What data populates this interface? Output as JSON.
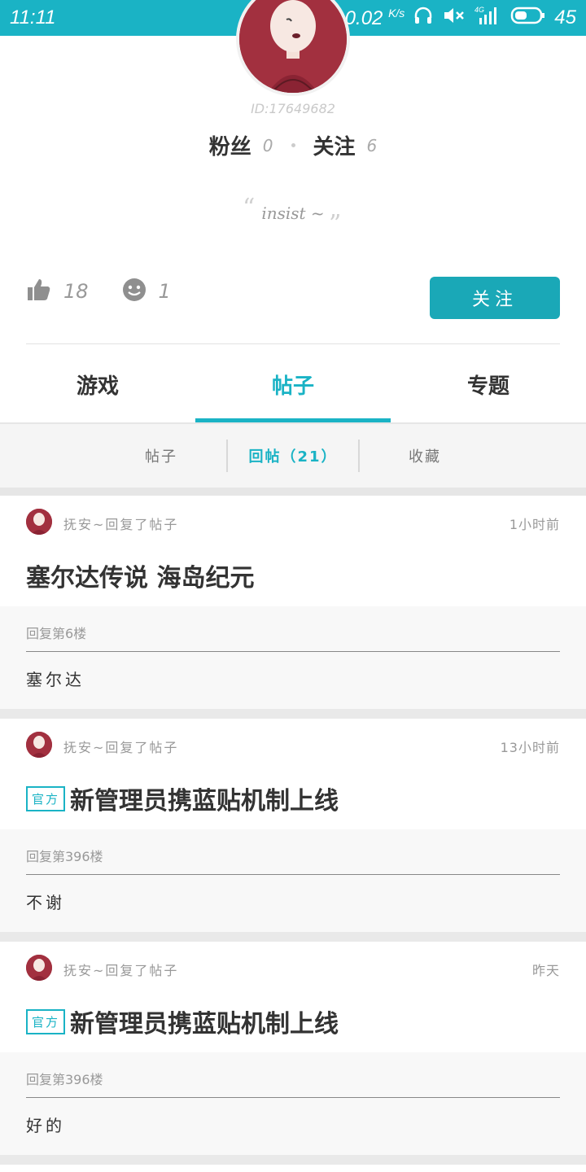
{
  "status_bar": {
    "time": "11:11",
    "net_speed": "0.02",
    "net_unit": "K/s",
    "network": "4G",
    "battery": "45",
    "icons": [
      "headphones-icon",
      "mute-icon",
      "signal-icon",
      "battery-icon"
    ]
  },
  "profile": {
    "user_id": "ID:17649682",
    "fans_label": "粉丝",
    "fans_count": "0",
    "following_label": "关注",
    "following_count": "6",
    "motto": "insist ~",
    "likes": "18",
    "smiles": "1",
    "follow_button": "关注"
  },
  "tabs": [
    {
      "label": "游戏",
      "active": false
    },
    {
      "label": "帖子",
      "active": true
    },
    {
      "label": "专题",
      "active": false
    }
  ],
  "subtabs": [
    {
      "label": "帖子",
      "active": false
    },
    {
      "label": "回帖（21）",
      "active": true
    },
    {
      "label": "收藏",
      "active": false
    }
  ],
  "posts": [
    {
      "user_action": "抚安~回复了帖子",
      "time": "1小时前",
      "badge": "",
      "title": "塞尔达传说 海岛纪元",
      "floor": "回复第6楼",
      "reply": "塞尔达"
    },
    {
      "user_action": "抚安~回复了帖子",
      "time": "13小时前",
      "badge": "官方",
      "title": "新管理员携蓝贴机制上线",
      "floor": "回复第396楼",
      "reply": "不谢"
    },
    {
      "user_action": "抚安~回复了帖子",
      "time": "昨天",
      "badge": "官方",
      "title": "新管理员携蓝贴机制上线",
      "floor": "回复第396楼",
      "reply": "好的"
    }
  ],
  "colors": {
    "accent": "#1ab3c5",
    "avatar": "#a2303f"
  }
}
